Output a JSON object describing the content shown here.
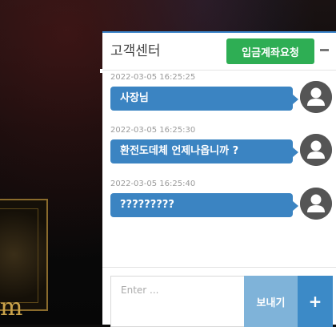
{
  "chat": {
    "title": "고객센터",
    "deposit_button_label": "입금계좌요청",
    "minimize_icon": "minus-icon",
    "messages": [
      {
        "time": "2022-03-05 16:25:25",
        "text": "사장님"
      },
      {
        "time": "2022-03-05 16:25:30",
        "text": "환전도데체 언제나옵니까 ?"
      },
      {
        "time": "2022-03-05 16:25:40",
        "text": "?????????"
      }
    ],
    "input_placeholder": "Enter ...",
    "send_label": "보내기",
    "attach_label": "+"
  },
  "background": {
    "partial_letter": "m"
  },
  "colors": {
    "header_accent": "#3b84c9",
    "deposit_button": "#2eae54",
    "bubble": "#3b84c2",
    "send_button": "#7fb3d9",
    "attach_button": "#3c8ac7",
    "avatar": "#555555"
  }
}
